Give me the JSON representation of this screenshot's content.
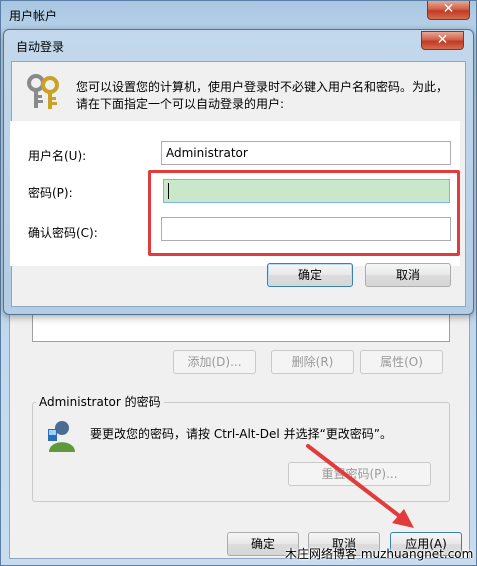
{
  "outer_window": {
    "title": "用户帐户",
    "close_glyph": "✕",
    "buttons": {
      "add": "添加(D)...",
      "remove": "删除(R)",
      "properties": "属性(O)"
    },
    "password_group": {
      "title": "Administrator 的密码",
      "instruction": "要更改您的密码，请按 Ctrl-Alt-Del 并选择“更改密码”。",
      "reset_button": "重置密码(P)..."
    },
    "footer": {
      "ok": "确定",
      "cancel": "取消",
      "apply": "应用(A)"
    },
    "watermark": "木庄网络博客 muzhuangnet.com"
  },
  "dialog": {
    "title": "自动登录",
    "close_glyph": "✕",
    "description_line1": "您可以设置您的计算机，使用户登录时不必键入用户名和密码。为此，",
    "description_line2": "请在下面指定一个可以自动登录的用户:",
    "fields": {
      "username_label": "用户名(U):",
      "username_value": "Administrator",
      "password_label": "密码(P):",
      "confirm_label": "确认密码(C):"
    },
    "ok": "确定",
    "cancel": "取消"
  },
  "icons": {
    "dialog_icon": "keys-icon",
    "password_icon": "user-key-icon",
    "annotation": "red-arrow-icon"
  },
  "colors": {
    "highlight_box": "#e23b3b",
    "password_field_bg": "#c9e8c9",
    "titlebar": "#b3cde5"
  }
}
